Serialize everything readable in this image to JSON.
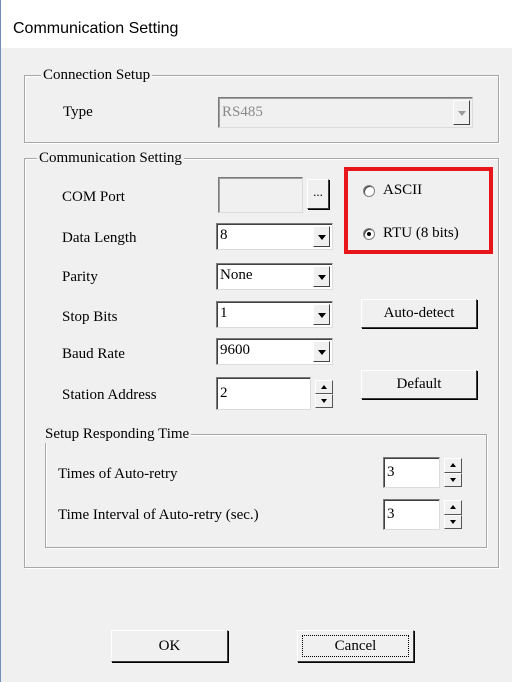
{
  "window": {
    "title": "Communication Setting"
  },
  "connection_setup": {
    "legend": "Connection Setup",
    "type_label": "Type",
    "type_value": "RS485"
  },
  "communication_setting": {
    "legend": "Communication Setting",
    "com_port_label": "COM Port",
    "com_port_value": "",
    "browse_label": "...",
    "data_length_label": "Data Length",
    "data_length_value": "8",
    "parity_label": "Parity",
    "parity_value": "None",
    "stop_bits_label": "Stop Bits",
    "stop_bits_value": "1",
    "baud_rate_label": "Baud Rate",
    "baud_rate_value": "9600",
    "station_address_label": "Station Address",
    "station_address_value": "2",
    "mode_options": [
      {
        "label": "ASCII",
        "checked": false
      },
      {
        "label": "RTU (8 bits)",
        "checked": true
      }
    ],
    "auto_detect_label": "Auto-detect",
    "default_label": "Default"
  },
  "responding_time": {
    "legend": "Setup Responding Time",
    "retry_times_label": "Times of Auto-retry",
    "retry_times_value": "3",
    "retry_interval_label": "Time Interval of Auto-retry (sec.)",
    "retry_interval_value": "3"
  },
  "footer": {
    "ok_label": "OK",
    "cancel_label": "Cancel"
  },
  "colors": {
    "highlight": "#e8161b",
    "dialog_bg": "#f0f0f0",
    "disabled_text": "#8a8a8a"
  }
}
